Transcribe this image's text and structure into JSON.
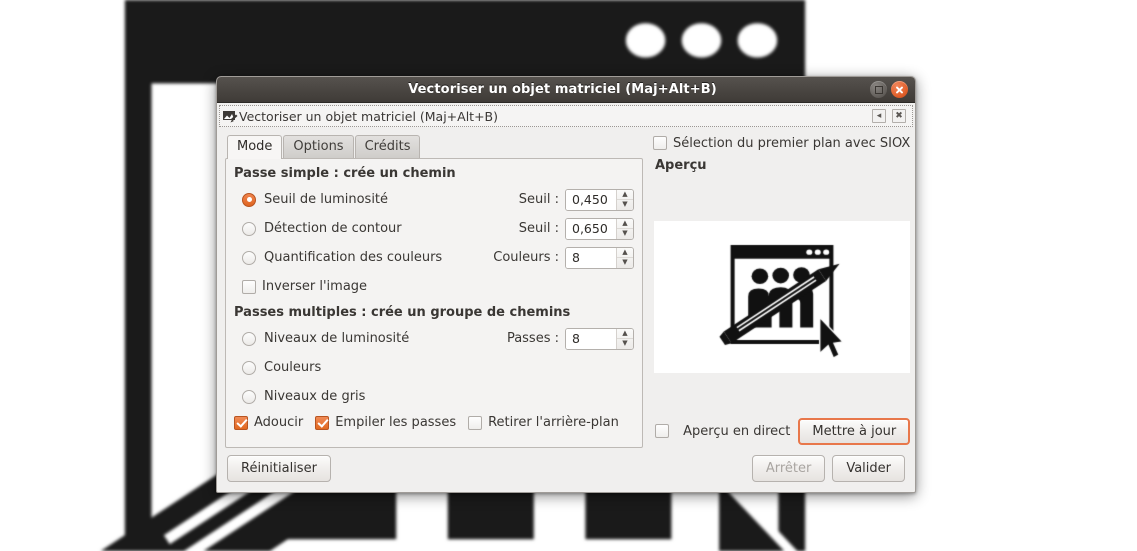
{
  "window": {
    "title": "Vectoriser un objet matriciel (Maj+Alt+B)",
    "restore_icon": "restore-icon",
    "close_icon": "close-icon"
  },
  "dock": {
    "icon": "vectorize-icon",
    "title": "Vectoriser un objet matriciel (Maj+Alt+B)",
    "collapse_glyph": "◂",
    "close_glyph": "✖"
  },
  "tabs": [
    {
      "label": "Mode",
      "active": true
    },
    {
      "label": "Options",
      "active": false
    },
    {
      "label": "Crédits",
      "active": false
    }
  ],
  "single_pass": {
    "group_title": "Passe simple : crée un chemin",
    "options": [
      {
        "label": "Seuil de luminosité",
        "selected": true,
        "field_label": "Seuil :",
        "value": "0,450"
      },
      {
        "label": "Détection de contour",
        "selected": false,
        "field_label": "Seuil :",
        "value": "0,650"
      },
      {
        "label": "Quantification des couleurs",
        "selected": false,
        "field_label": "Couleurs :",
        "value": "8"
      }
    ],
    "invert": {
      "label": "Inverser l'image",
      "checked": false
    }
  },
  "multi_pass": {
    "group_title": "Passes multiples : crée un groupe de chemins",
    "options": [
      {
        "label": "Niveaux de luminosité",
        "selected": false,
        "field_label": "Passes :",
        "value": "8"
      },
      {
        "label": "Couleurs",
        "selected": false
      },
      {
        "label": "Niveaux de gris",
        "selected": false
      }
    ],
    "checks": [
      {
        "label": "Adoucir",
        "checked": true
      },
      {
        "label": "Empiler les passes",
        "checked": true
      },
      {
        "label": "Retirer l'arrière-plan",
        "checked": false
      }
    ]
  },
  "preview_panel": {
    "siox": {
      "label": "Sélection du premier plan avec SIOX",
      "checked": false
    },
    "title": "Aperçu",
    "live_preview": {
      "label": "Aperçu en direct",
      "checked": false
    },
    "update_button": "Mettre à jour"
  },
  "footer": {
    "reset": "Réinitialiser",
    "stop": "Arrêter",
    "stop_disabled": true,
    "ok": "Valider"
  },
  "colors": {
    "accent_orange": "#e2681f",
    "focus_orange": "#e8774a",
    "titlebar_dark": "#4b4743",
    "dialog_bg": "#f0efee",
    "panel_bg": "#f4f3f2",
    "close_red": "#e05f2a",
    "artwork_black": "#111111",
    "artwork_white": "#ffffff"
  },
  "artwork": {
    "name": "raster-clipart-window-people-pencil-cursor",
    "description": "Black and white clip-art: a window with three dots in its title bar, three figures, a diagonal pencil and a mouse cursor"
  }
}
